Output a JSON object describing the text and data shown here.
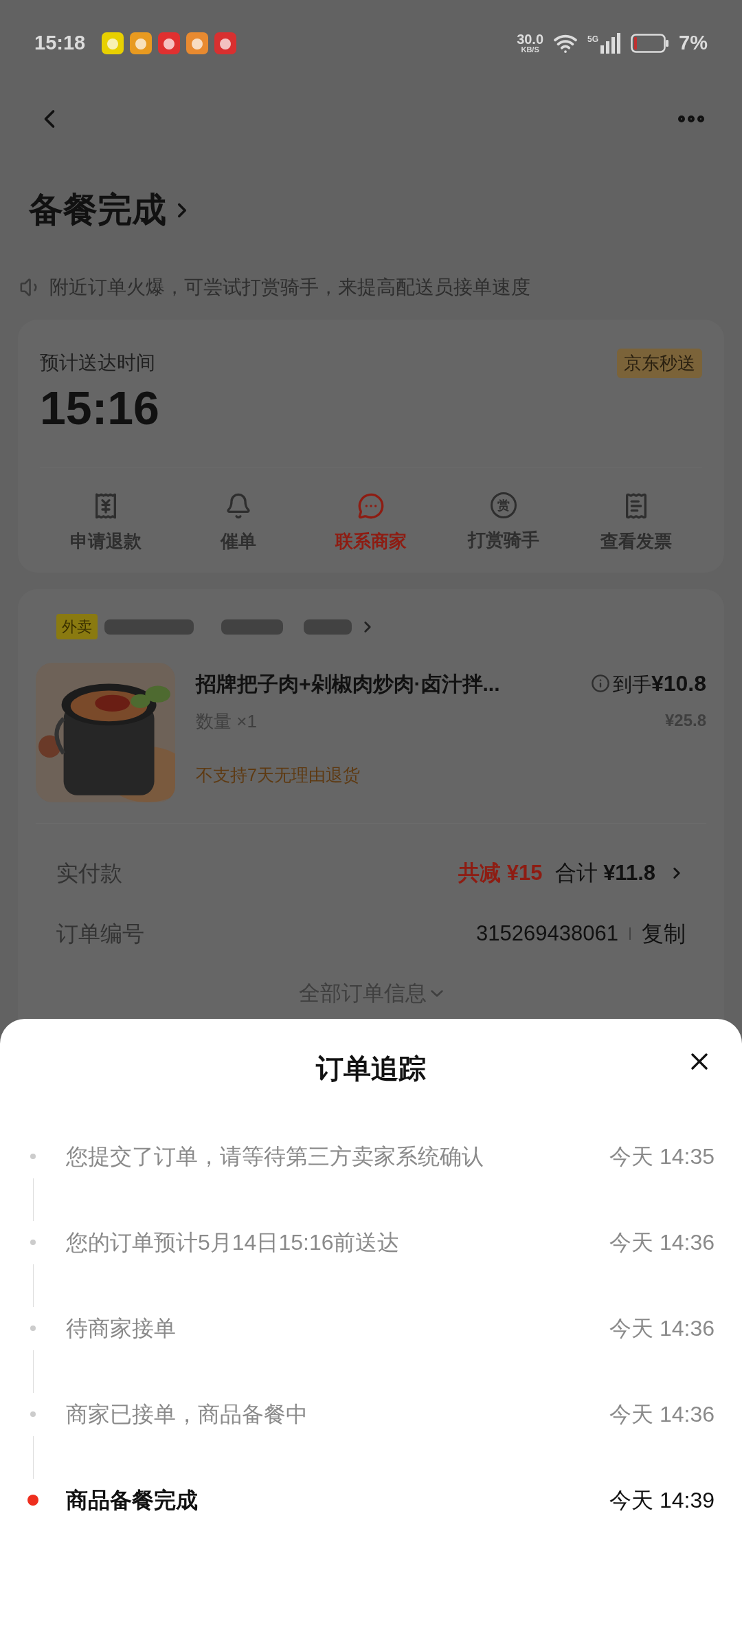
{
  "status_bar": {
    "time": "15:18",
    "net_speed": "30.0",
    "net_unit": "KB/S",
    "network": "5G",
    "battery": "7%"
  },
  "header": {
    "title": "备餐完成"
  },
  "notice": "附近订单火爆，可尝试打赏骑手，来提高配送员接单速度",
  "delivery": {
    "label": "预计送达时间",
    "time": "15:16",
    "badge": "京东秒送"
  },
  "actions": [
    {
      "kind": "refund",
      "label": "申请退款",
      "highlight": false
    },
    {
      "kind": "remind",
      "label": "催单",
      "highlight": false
    },
    {
      "kind": "contact",
      "label": "联系商家",
      "highlight": true
    },
    {
      "kind": "tip",
      "label": "打赏骑手",
      "icon_text": "赏",
      "highlight": false
    },
    {
      "kind": "invoice",
      "label": "查看发票",
      "highlight": false
    }
  ],
  "order": {
    "store_badge": "外卖",
    "item": {
      "name": "招牌把子肉+剁椒肉炒肉·卤汁拌...",
      "quantity": "数量 ×1",
      "notice": "不支持7天无理由退货",
      "final_price_label": "到手",
      "final_price": "¥10.8",
      "original_price": "¥25.8"
    },
    "paid": {
      "label": "实付款",
      "discount": "共减 ¥15",
      "total_label": "合计",
      "total": "¥11.8"
    },
    "order_no": {
      "label": "订单编号",
      "value": "315269438061",
      "copy": "复制"
    },
    "more": "全部订单信息"
  },
  "tracking": {
    "title": "订单追踪",
    "events": [
      {
        "text": "您提交了订单，请等待第三方卖家系统确认",
        "time": "今天 14:35",
        "current": false
      },
      {
        "text": "您的订单预计5月14日15:16前送达",
        "time": "今天 14:36",
        "current": false
      },
      {
        "text": "待商家接单",
        "time": "今天 14:36",
        "current": false
      },
      {
        "text": "商家已接单，商品备餐中",
        "time": "今天 14:36",
        "current": false
      },
      {
        "text": "商品备餐完成",
        "time": "今天 14:39",
        "current": true
      }
    ]
  }
}
